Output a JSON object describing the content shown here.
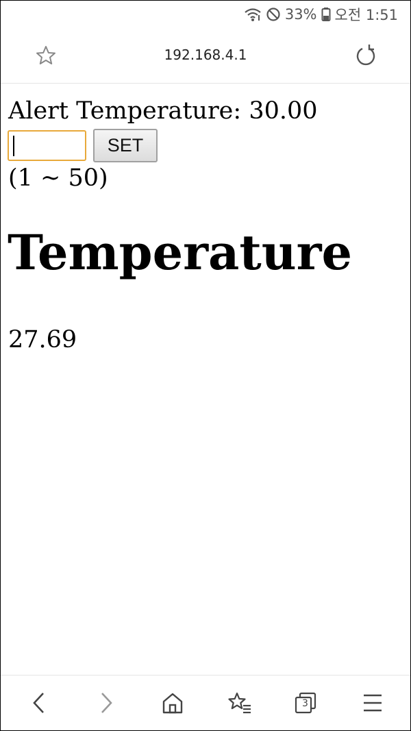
{
  "status_bar": {
    "battery_percent": "33%",
    "time": "오전 1:51",
    "icons": [
      "wifi-icon",
      "do-not-disturb-icon",
      "battery-icon"
    ]
  },
  "browser": {
    "url": "192.168.4.1",
    "icons": [
      "bookmark-star-icon",
      "reload-icon"
    ]
  },
  "page": {
    "alert_label": "Alert Temperature: 30.00",
    "input_value": "",
    "set_button_label": "SET",
    "range_hint": "(1 ~ 50)",
    "heading": "Temperature",
    "current_reading": "27.69"
  },
  "bottom_nav": {
    "tab_count": "3",
    "icons": [
      "back-icon",
      "forward-icon",
      "home-icon",
      "bookmarks-icon",
      "tabs-icon",
      "menu-icon"
    ]
  },
  "colors": {
    "input_focus_border": "#e8a93a",
    "icon_gray": "#555555",
    "forward_disabled": "#999999"
  }
}
